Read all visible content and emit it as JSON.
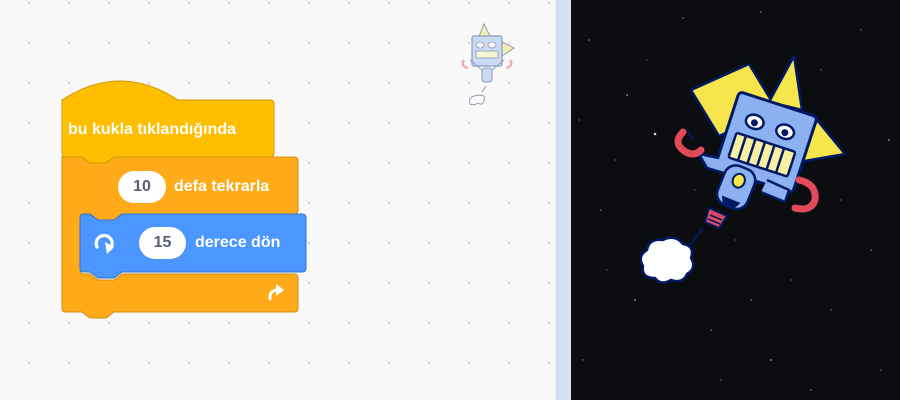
{
  "script": {
    "hat_label": "bu kukla tıklandığında",
    "repeat": {
      "count": "10",
      "label": "defa tekrarla"
    },
    "turn": {
      "degrees": "15",
      "label": "derece dön"
    }
  },
  "icons": {
    "turn": "rotate-clockwise-icon",
    "loop": "loop-arrow-icon",
    "workspace_sprite": "robot-sprite-thumbnail",
    "stage_sprite": "robot-sprite"
  },
  "colors": {
    "events": "#ffbf00",
    "control": "#ffab19",
    "motion": "#4c97ff",
    "stage_background": "#0b0d10"
  }
}
